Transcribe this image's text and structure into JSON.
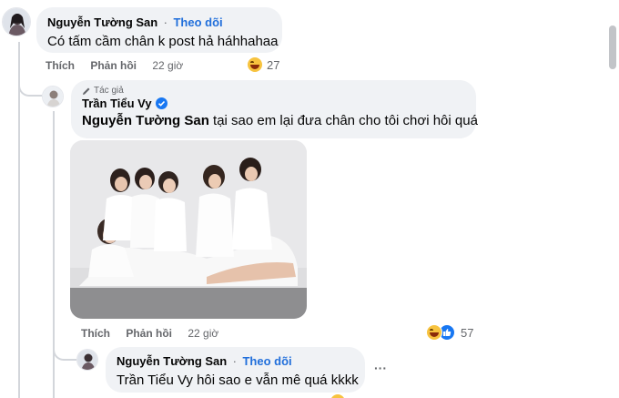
{
  "comments": {
    "top": {
      "author": "Nguyễn Tường San",
      "follow_label": "Theo dõi",
      "separator": "·",
      "text": "Có tấm cầm chân k post hả háhhahaa",
      "like_label": "Thích",
      "reply_label": "Phản hồi",
      "time": "22 giờ",
      "reaction_count": "27"
    },
    "reply": {
      "author_badge": "Tác giả",
      "author": "Trần Tiểu Vy",
      "tag": "Nguyễn Tường San",
      "text": "tại sao em lại đưa chân cho tôi chơi hôi quá",
      "like_label": "Thích",
      "reply_label": "Phản hồi",
      "time": "22 giờ",
      "reaction_count": "57"
    },
    "reply2": {
      "author": "Nguyễn Tường San",
      "follow_label": "Theo dõi",
      "separator": "·",
      "tag": "Trần Tiểu Vy",
      "text": "hôi sao e vẫn mê quá kkkk",
      "more_label": "···"
    }
  },
  "colors": {
    "bubble": "#f0f2f5",
    "link": "#216fdb",
    "verified": "#1877f2"
  },
  "icons": [
    "pencil-icon",
    "verified-icon",
    "haha-icon",
    "like-icon",
    "more-icon"
  ]
}
